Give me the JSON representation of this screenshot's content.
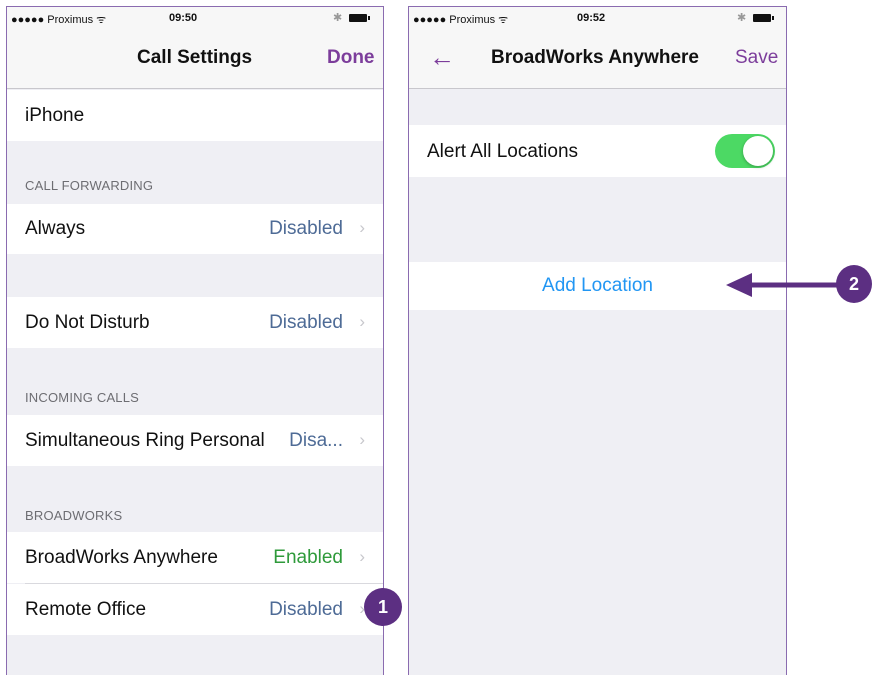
{
  "left_screen": {
    "status": {
      "carrier": "●●●●● Proximus ᯤ",
      "time": "09:50"
    },
    "title": "Call Settings",
    "done_label": "Done",
    "device": "iPhone",
    "sections": {
      "call_forwarding": "CALL FORWARDING",
      "incoming_calls": "INCOMING CALLS",
      "broadworks": "BROADWORKS"
    },
    "rows": {
      "always": {
        "label": "Always",
        "value": "Disabled"
      },
      "dnd": {
        "label": "Do Not Disturb",
        "value": "Disabled"
      },
      "sim_ring": {
        "label": "Simultaneous Ring Personal",
        "value": "Disa..."
      },
      "bw_anywhere": {
        "label": "BroadWorks Anywhere",
        "value": "Enabled"
      },
      "remote_office": {
        "label": "Remote Office",
        "value": "Disabled"
      }
    },
    "chevron": "›"
  },
  "right_screen": {
    "status": {
      "carrier": "●●●●● Proximus ᯤ",
      "time": "09:52"
    },
    "back_icon": "←",
    "title": "BroadWorks Anywhere",
    "save_label": "Save",
    "alert_all_label": "Alert All Locations",
    "alert_all_on": true,
    "add_location_label": "Add Location"
  },
  "callouts": {
    "one": "1",
    "two": "2"
  },
  "colors": {
    "accent": "#7c3d9b",
    "badge": "#5c2f82",
    "toggle_on": "#4cd964",
    "link": "#2196f3"
  }
}
